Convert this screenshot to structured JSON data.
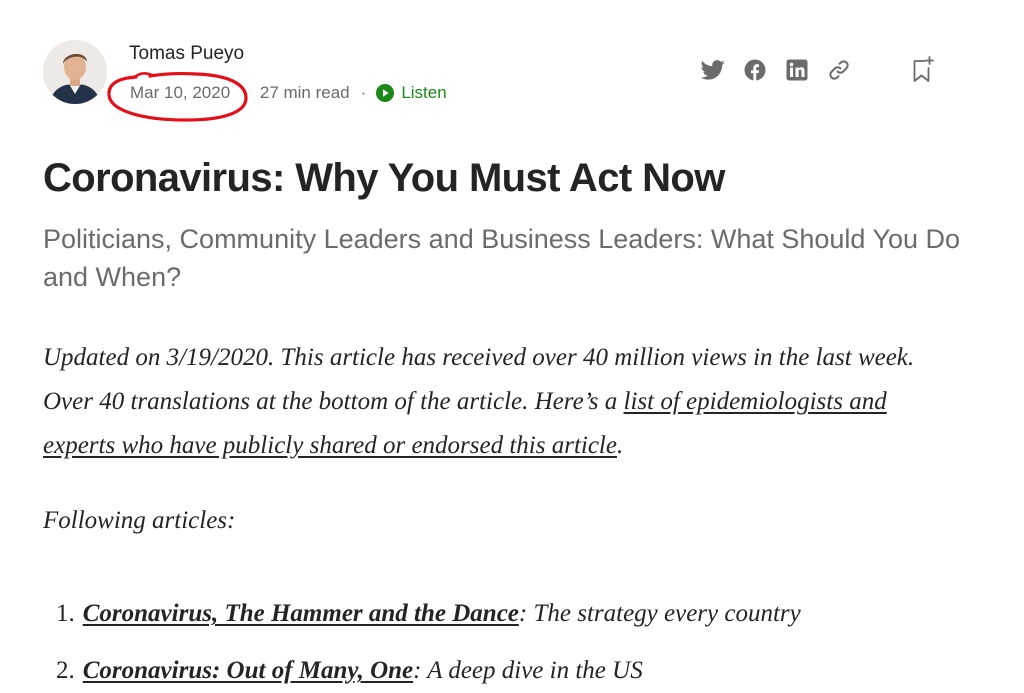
{
  "author": {
    "name": "Tomas Pueyo"
  },
  "meta": {
    "date": "Mar 10, 2020",
    "read_time": "27 min read",
    "separator": "·",
    "listen_label": "Listen"
  },
  "share": {
    "icons": [
      "twitter-icon",
      "facebook-icon",
      "linkedin-icon",
      "link-icon"
    ],
    "bookmark_icon": "bookmark-add-icon"
  },
  "article": {
    "title": "Coronavirus: Why You Must Act Now",
    "subtitle": "Politicians, Community Leaders and Business Leaders: What Should You Do and When?",
    "intro_text": "Updated on 3/19/2020. This article has received over 40 million views in the last week. Over 40 translations at the bottom of the article. Here’s a ",
    "intro_link": "list of epidemiologists and experts who have publicly shared or endorsed this article",
    "intro_end": ".",
    "following_label": "Following articles:",
    "following": [
      {
        "num": "1.",
        "link": "Coronavirus, The Hammer and the Dance",
        "desc": ": The strategy every country"
      },
      {
        "num": "2.",
        "link": "Coronavirus: Out of Many, One",
        "desc": ": A deep dive in the US"
      }
    ]
  },
  "colors": {
    "text": "#242424",
    "muted": "#6b6b6b",
    "listen_green": "#1a8917",
    "annotation_red": "#e3101a"
  }
}
